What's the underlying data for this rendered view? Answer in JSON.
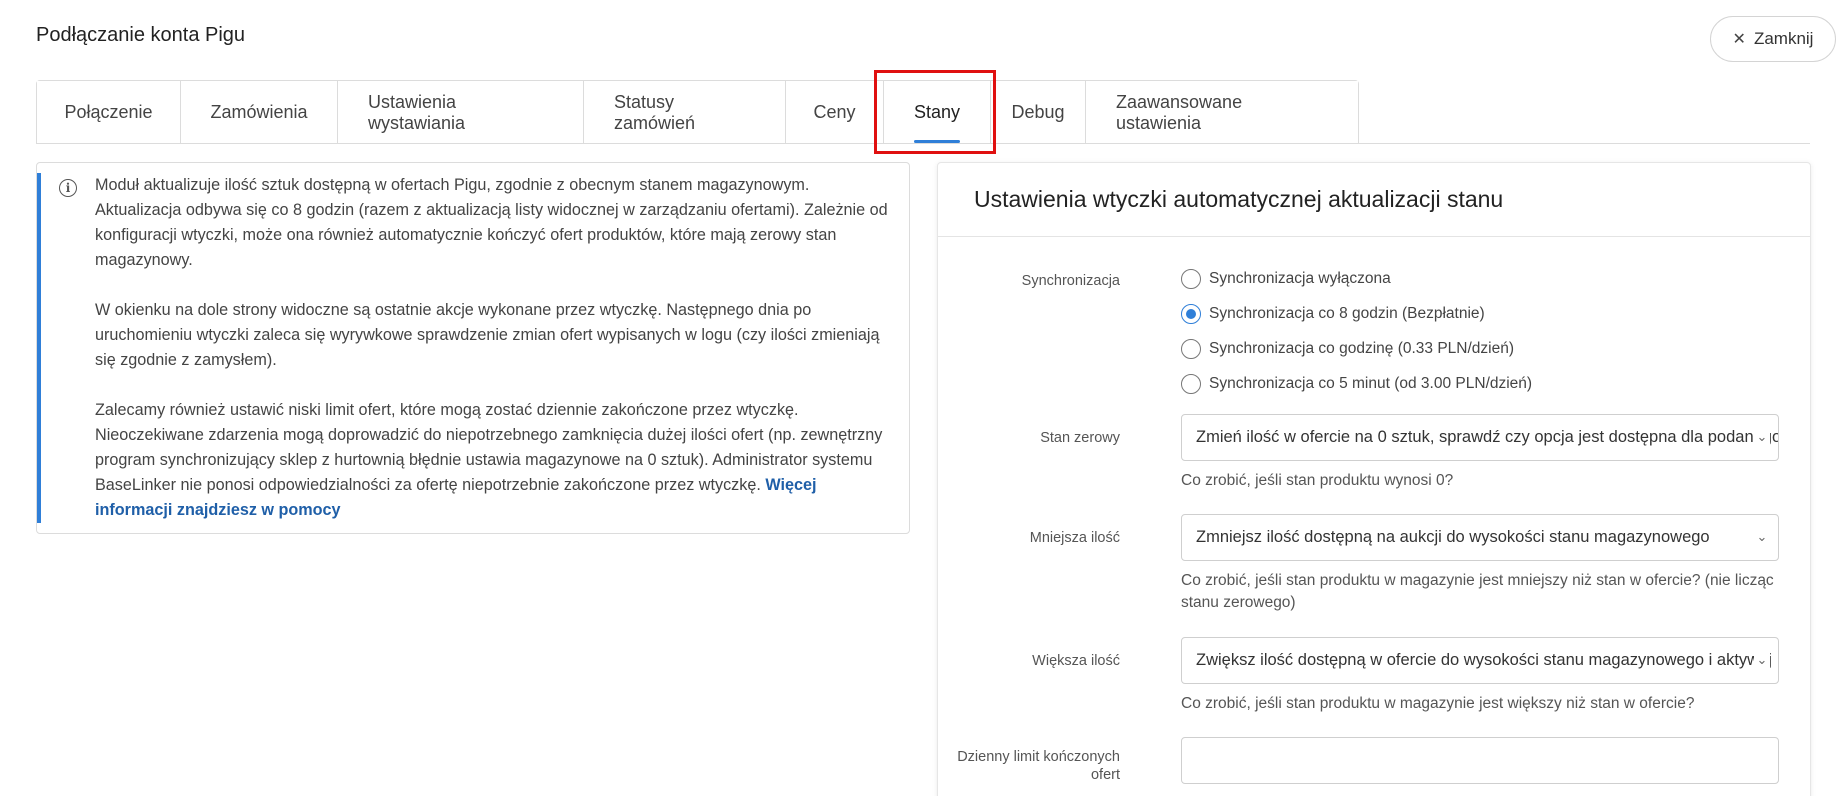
{
  "dialog": {
    "title": "Podłączanie konta Pigu",
    "close_label": "Zamknij"
  },
  "tabs": [
    {
      "label": "Połączenie"
    },
    {
      "label": "Zamówienia"
    },
    {
      "label": "Ustawienia wystawiania"
    },
    {
      "label": "Statusy zamówień"
    },
    {
      "label": "Ceny"
    },
    {
      "label": "Stany",
      "active": true
    },
    {
      "label": "Debug"
    },
    {
      "label": "Zaawansowane ustawienia"
    }
  ],
  "info": {
    "p1": "Moduł aktualizuje ilość sztuk dostępną w ofertach Pigu, zgodnie z obecnym stanem magazynowym. Aktualizacja odbywa się co 8 godzin (razem z aktualizacją listy widocznej w zarządzaniu ofertami). Zależnie od konfiguracji wtyczki, może ona również automatycznie kończyć ofert produktów, które mają zerowy stan magazynowy.",
    "p2": "W okienku na dole strony widoczne są ostatnie akcje wykonane przez wtyczkę. Następnego dnia po uruchomieniu wtyczki zaleca się wyrywkowe sprawdzenie zmian ofert wypisanych w logu (czy ilości zmieniają się zgodnie z zamysłem).",
    "p3": "Zalecamy również ustawić niski limit ofert, które mogą zostać dziennie zakończone przez wtyczkę. Nieoczekiwane zdarzenia mogą doprowadzić do niepotrzebnego zamknięcia dużej ilości ofert (np. zewnętrzny program synchronizujący sklep z hurtownią błędnie ustawia magazynowe na 0 sztuk). Administrator systemu BaseLinker nie ponosi odpowiedzialności za ofertę niepotrzebnie zakończone przez wtyczkę. ",
    "link": "Więcej informacji znajdziesz w pomocy"
  },
  "settings": {
    "title": "Ustawienia wtyczki automatycznej aktualizacji stanu",
    "sync_label": "Synchronizacja",
    "sync_options": [
      {
        "label": "Synchronizacja wyłączona",
        "checked": false
      },
      {
        "label": "Synchronizacja co 8 godzin (Bezpłatnie)",
        "checked": true
      },
      {
        "label": "Synchronizacja co godzinę (0.33 PLN/dzień)",
        "checked": false
      },
      {
        "label": "Synchronizacja co 5 minut (od 3.00 PLN/dzień)",
        "checked": false
      }
    ],
    "zero_label": "Stan zerowy",
    "zero_value": "Zmień ilość w ofercie na 0 sztuk, sprawdź czy opcja jest dostępna dla podanego",
    "zero_hint": "Co zrobić, jeśli stan produktu wynosi 0?",
    "less_label": "Mniejsza ilość",
    "less_value": "Zmniejsz ilość dostępną na aukcji do wysokości stanu magazynowego",
    "less_hint": "Co zrobić, jeśli stan produktu w magazynie jest mniejszy niż stan w ofercie? (nie licząc stanu zerowego)",
    "more_label": "Większa ilość",
    "more_value": "Zwiększ ilość dostępną w ofercie do wysokości stanu magazynowego i aktywuj",
    "more_hint": "Co zrobić, jeśli stan produktu w magazynie jest większy niż stan w ofercie?",
    "limit_label": "Dzienny limit kończonych ofert",
    "limit_value": ""
  }
}
